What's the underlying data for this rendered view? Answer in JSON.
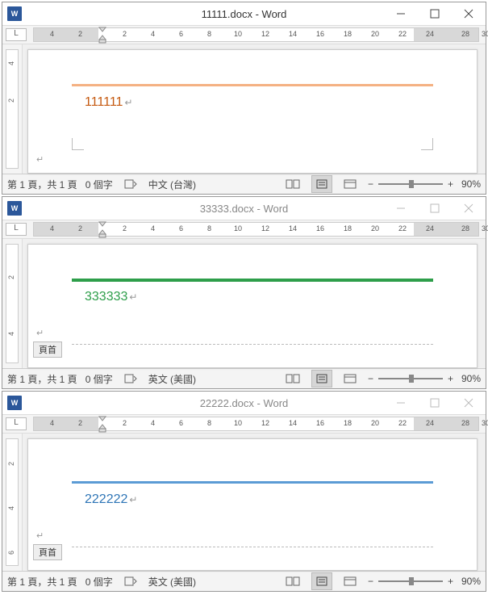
{
  "windows": [
    {
      "title": "11111.docx - Word",
      "active": true,
      "ruler_numbers": [
        "4",
        "2",
        "2",
        "4",
        "6",
        "8",
        "10",
        "12",
        "14",
        "16",
        "18",
        "20",
        "22",
        "24",
        "28",
        "30"
      ],
      "vruler_numbers": [
        "4",
        "2"
      ],
      "line_color": "#f4b183",
      "text": "111111",
      "text_color_class": "t-orange",
      "line_class": "hr-orange",
      "show_header_label": false,
      "status": {
        "page": "第 1 頁，共 1 頁",
        "words": "0 個字",
        "lang": "中文 (台灣)",
        "zoom": "90%"
      }
    },
    {
      "title": "33333.docx - Word",
      "active": false,
      "ruler_numbers": [
        "4",
        "2",
        "2",
        "4",
        "6",
        "8",
        "10",
        "12",
        "14",
        "16",
        "18",
        "20",
        "22",
        "24",
        "28",
        "30"
      ],
      "vruler_numbers": [
        "2",
        "4"
      ],
      "line_color": "#2e9e4a",
      "text": "333333",
      "text_color_class": "t-green",
      "line_class": "hr-green",
      "show_header_label": true,
      "header_label": "頁首",
      "status": {
        "page": "第 1 頁，共 1 頁",
        "words": "0 個字",
        "lang": "英文 (美國)",
        "zoom": "90%"
      }
    },
    {
      "title": "22222.docx - Word",
      "active": false,
      "ruler_numbers": [
        "4",
        "2",
        "2",
        "4",
        "6",
        "8",
        "10",
        "12",
        "14",
        "16",
        "18",
        "20",
        "22",
        "24",
        "28",
        "30"
      ],
      "vruler_numbers": [
        "2",
        "4",
        "6"
      ],
      "line_color": "#5b9bd5",
      "text": "222222",
      "text_color_class": "t-blue",
      "line_class": "hr-blue",
      "show_header_label": true,
      "header_label": "頁首",
      "status": {
        "page": "第 1 頁，共 1 頁",
        "words": "0 個字",
        "lang": "英文 (美國)",
        "zoom": "90%"
      }
    }
  ],
  "icons": {
    "tab_selector": "L",
    "para": "↵",
    "word_logo": "W"
  }
}
